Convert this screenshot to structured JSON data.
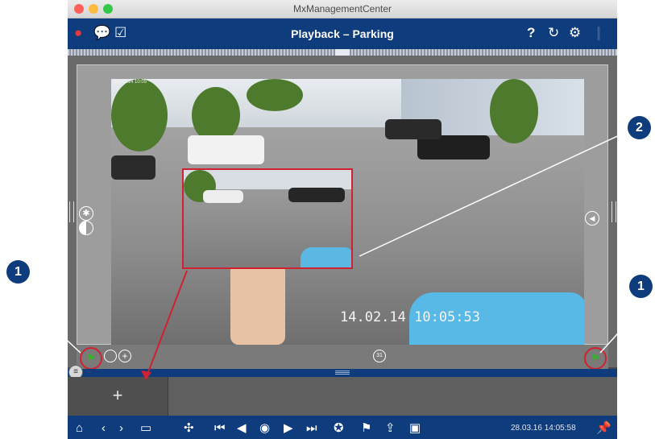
{
  "window": {
    "title": "MxManagementCenter"
  },
  "toolbar": {
    "title": "Playback – Parking",
    "left_icons": [
      "alarm-icon",
      "chat-icon",
      "checkbox-icon"
    ],
    "right_icons": [
      "help-icon",
      "refresh-icon",
      "settings-icon",
      "pin-icon"
    ],
    "help_glyph": "?",
    "refresh_glyph": "↻",
    "settings_glyph": "⚙"
  },
  "camera": {
    "timestamp": "14.02.14 10:05:53",
    "corner_text": "14.02.14 10:05"
  },
  "controls": {
    "calendar_label": "31",
    "add_label": "+"
  },
  "bottom_bar": {
    "datetime": "28.03.16 14:05:58",
    "icons": [
      "home-icon",
      "back-icon",
      "forward-icon",
      "camera-icon",
      "puzzle-icon",
      "skip-start-icon",
      "step-back-icon",
      "play-icon",
      "step-forward-icon",
      "skip-end-icon",
      "film-icon",
      "flag-icon",
      "export-icon",
      "snapshot-icon",
      "pin-icon"
    ]
  },
  "callouts": {
    "one": "1",
    "two": "2"
  },
  "colors": {
    "navy": "#0f3c7c",
    "highlight": "#d1202f",
    "flag": "#3cae2d"
  }
}
